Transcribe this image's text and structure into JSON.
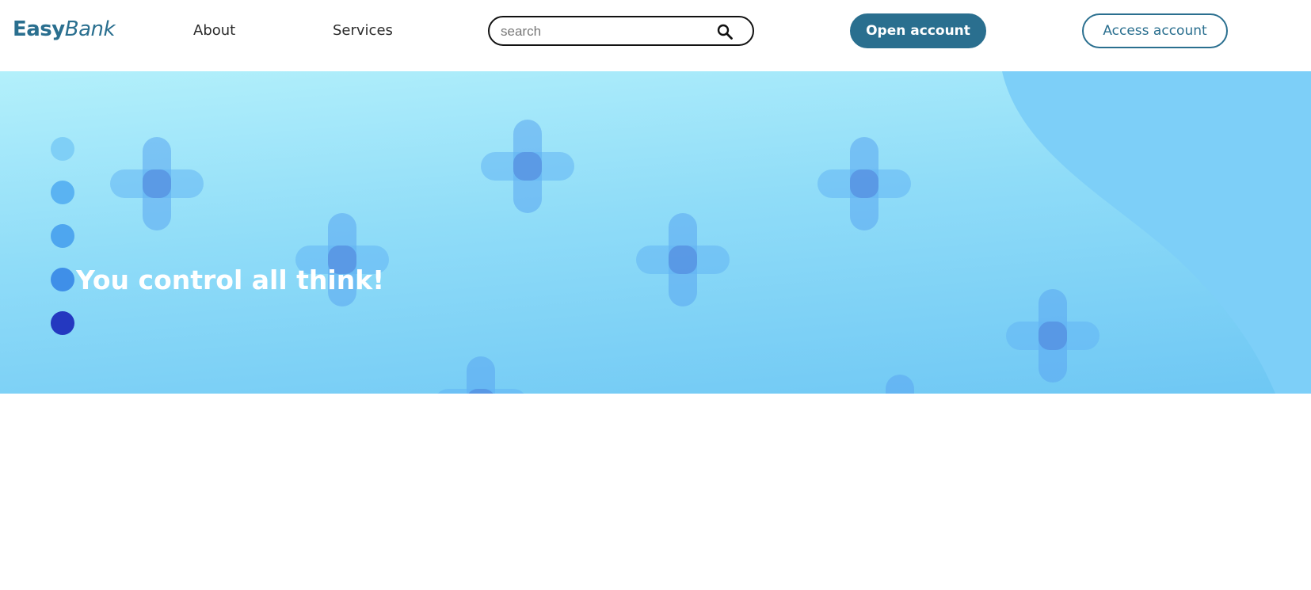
{
  "header": {
    "logo_part1": "Easy",
    "logo_part2": "Bank",
    "nav": {
      "about": "About",
      "services": "Services"
    },
    "search": {
      "placeholder": "search",
      "value": ""
    },
    "open_account": "Open account",
    "access_account": "Access account"
  },
  "hero": {
    "title": "You control all think!",
    "slider_dots": [
      {
        "color": "#7fcff6"
      },
      {
        "color": "#5ab3f2"
      },
      {
        "color": "#4ea6ef"
      },
      {
        "color": "#3f8fe8"
      },
      {
        "color": "#2438c0",
        "active": true
      }
    ]
  },
  "colors": {
    "brand": "#2a6f8f",
    "hero_light": "#b3f0fb",
    "hero_dark": "#6ec7f4"
  },
  "icons": {
    "search": "search-icon",
    "decor": "plus-shape"
  }
}
